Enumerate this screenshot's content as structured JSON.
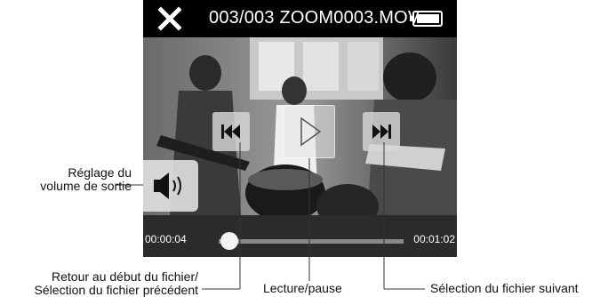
{
  "topbar": {
    "close_icon": "close-x-icon",
    "file_title": "003/003 ZOOM0003.MOV",
    "battery_icon": "battery-icon"
  },
  "controls": {
    "previous_icon": "skip-previous-icon",
    "play_icon": "play-icon",
    "next_icon": "skip-next-icon",
    "volume_icon": "speaker-volume-icon"
  },
  "playback": {
    "elapsed": "00:00:04",
    "total": "00:01:02",
    "progress_fraction": 0.06
  },
  "callouts": {
    "volume_line1": "Réglage du",
    "volume_line2": "volume de sortie",
    "prev_line1": "Retour au début du fichier/",
    "prev_line2": "Sélection du fichier précédent",
    "play": "Lecture/pause",
    "next": "Sélection du fichier suivant"
  },
  "colors": {
    "screen_bg": "#000000",
    "button_bg": "#d7d7d7",
    "text_light": "#ffffff"
  }
}
